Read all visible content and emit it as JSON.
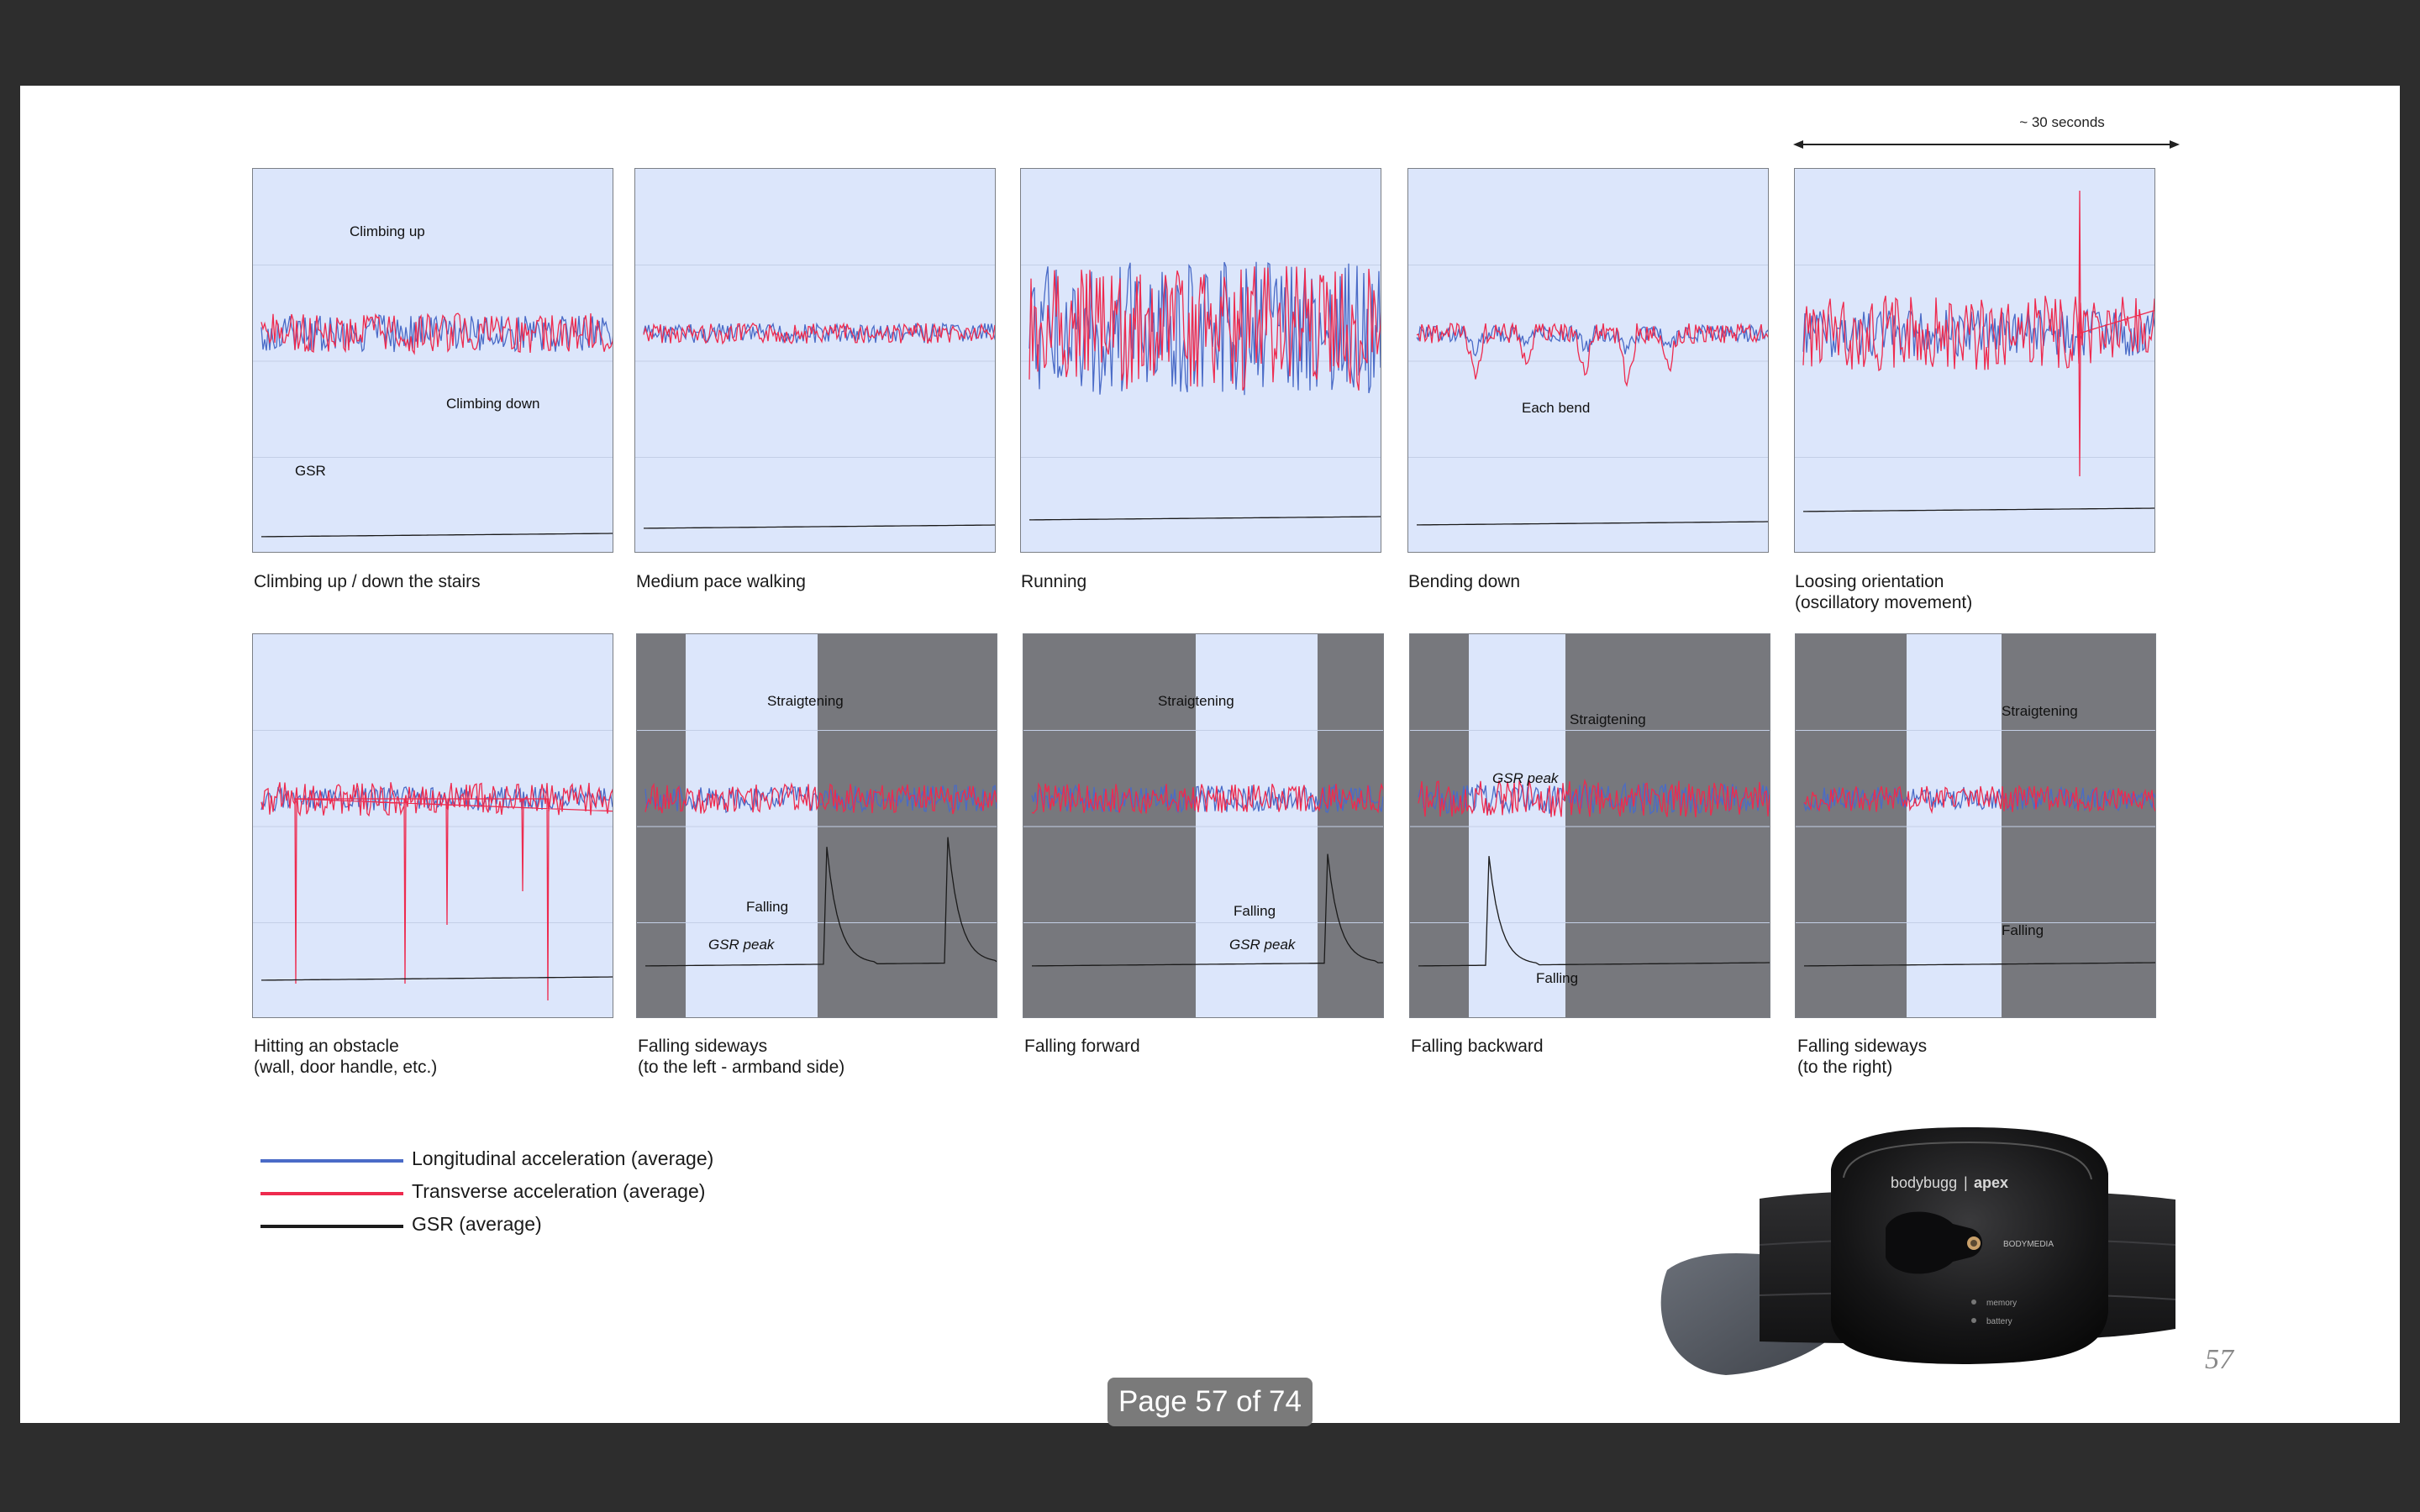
{
  "colors": {
    "longitudinal": "#4a6bc7",
    "transverse": "#ee2a4e",
    "gsr": "#1b1b1b",
    "panel_bg": "#dce6fb",
    "shade": "#77787d",
    "frame_bg": "#2d2d2d"
  },
  "time_span_label": "~ 30 seconds",
  "panels": [
    {
      "caption": "Climbing up / down the stairs",
      "annotations": [
        "Climbing up",
        "Climbing down",
        "GSR"
      ]
    },
    {
      "caption": "Medium pace walking",
      "annotations": []
    },
    {
      "caption": "Running",
      "annotations": []
    },
    {
      "caption": "Bending down",
      "annotations": [
        "Each bend"
      ]
    },
    {
      "caption": "Loosing orientation\n(oscillatory movement)",
      "annotations": []
    },
    {
      "caption": "Hitting an obstacle\n(wall, door handle, etc.)",
      "annotations": []
    },
    {
      "caption": "Falling sideways\n(to the left - armband side)",
      "annotations": [
        "Straigtening",
        "Falling",
        "GSR peak"
      ]
    },
    {
      "caption": "Falling forward",
      "annotations": [
        "Straigtening",
        "Falling",
        "GSR peak"
      ]
    },
    {
      "caption": "Falling backward",
      "annotations": [
        "Straigtening",
        "GSR peak",
        "Falling"
      ]
    },
    {
      "caption": "Falling sideways\n(to the right)",
      "annotations": [
        "Straigtening",
        "Falling"
      ]
    }
  ],
  "legend": [
    {
      "label": "Longitudinal acceleration (average)",
      "color": "#4a6bc7"
    },
    {
      "label": "Transverse acceleration (average)",
      "color": "#ee2a4e"
    },
    {
      "label": "GSR (average)",
      "color": "#1b1b1b"
    }
  ],
  "device": {
    "brand_left": "bodybugg",
    "brand_right": "apex",
    "maker": "BODYMEDIA",
    "indicator_1": "memory",
    "indicator_2": "battery"
  },
  "slide_page_number": "57",
  "viewer_page_indicator": "Page 57 of 74"
}
